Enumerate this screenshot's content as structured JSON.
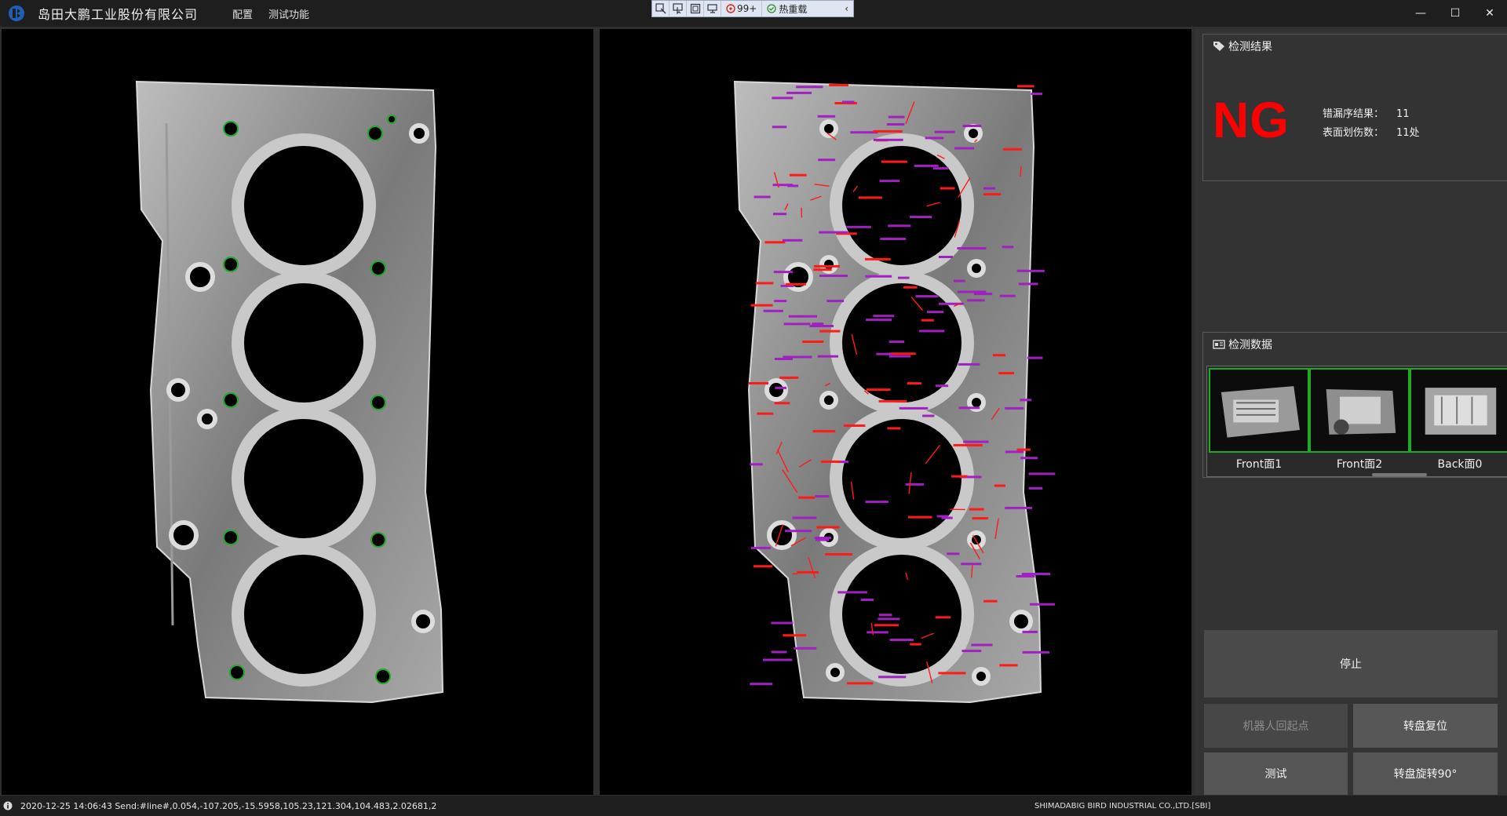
{
  "app": {
    "title": "岛田大鹏工业股份有限公司",
    "menu": [
      {
        "label": "配置"
      },
      {
        "label": "测试功能"
      }
    ]
  },
  "float_toolbar": {
    "badge": "99+",
    "hot_label": "热重载"
  },
  "window_controls": {
    "minimize": "—",
    "maximize": "☐",
    "close": "✕"
  },
  "result_panel": {
    "title": "检测结果",
    "result": "NG",
    "result_color": "#ff0000",
    "stats": [
      {
        "label": "错漏序结果：",
        "value": "11"
      },
      {
        "label": "表面划伤数：",
        "value": "11处"
      }
    ]
  },
  "data_panel": {
    "title": "检测数据",
    "thumbnails": [
      {
        "label": "Front面1"
      },
      {
        "label": "Front面2"
      },
      {
        "label": "Back面0"
      }
    ]
  },
  "buttons": {
    "stop": "停止",
    "robot_home": "机器人回起点",
    "turntable_reset": "转盘复位",
    "test": "测试",
    "turntable_rotate": "转盘旋转90°"
  },
  "statusbar": {
    "message": "2020-12-25 14:06:43 Send:#line#,0.054,-107.205,-15.5958,105.23,121.304,104.483,2.02681,2",
    "company": "SHIMADABIG BIRD INDUSTRIAL CO.,LTD.[SBI]"
  },
  "colors": {
    "ok_marker": "#1faa2a",
    "defect_mark": "#ff1a1a",
    "defect_label": "#a020c0"
  }
}
